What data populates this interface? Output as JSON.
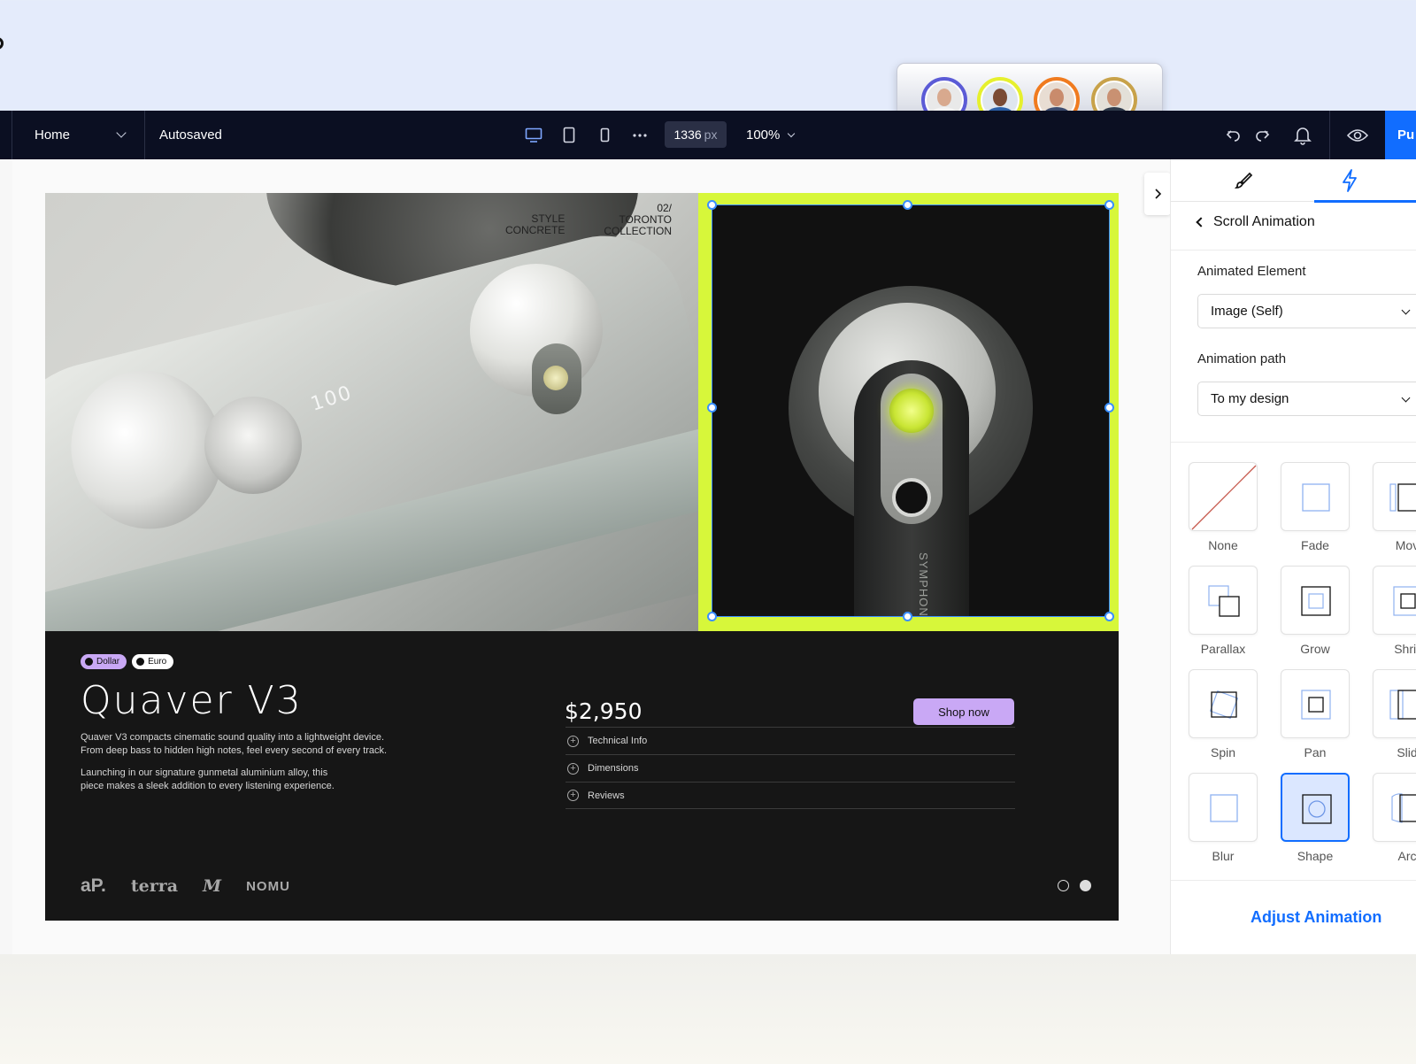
{
  "colors": {
    "topbar_bg": "#0b0f22",
    "accent": "#116dff",
    "selection_frame": "#d7f73a",
    "shop_button": "#c9a8f5"
  },
  "collaborators": {
    "avatars": [
      {
        "name": "collaborator-1",
        "ring": "#5b5bd6",
        "shirt": "#f2f2f2"
      },
      {
        "name": "collaborator-2",
        "ring": "#e6f02e",
        "shirt": "#2a5fa8"
      },
      {
        "name": "collaborator-3",
        "ring": "#f07b1f",
        "shirt": "#3a4a6e"
      },
      {
        "name": "collaborator-4",
        "ring": "#c8a24a",
        "shirt": "#2e3a4a"
      }
    ]
  },
  "topbar": {
    "page_label": "Home",
    "status": "Autosaved",
    "width_value": "1336",
    "width_unit": "px",
    "zoom": "100%",
    "more_icon": "ellipsis-icon",
    "publish_label": "Pu"
  },
  "site": {
    "hero": {
      "meta_left": [
        "STYLE",
        "CONCRETE"
      ],
      "meta_right": [
        "02/",
        "TORONTO",
        "COLLECTION"
      ],
      "engraving": "100",
      "vertical_text": "SYMPHON"
    },
    "currency": {
      "dollar": "Dollar",
      "euro": "Euro"
    },
    "title": "Quaver V3",
    "desc_1": [
      "Quaver V3 compacts cinematic sound quality into a lightweight device.",
      "From deep bass to hidden high notes, feel every second of every track."
    ],
    "desc_2": [
      "Launching in our signature gunmetal  aluminium alloy, this",
      "piece makes a sleek addition to every listening experience."
    ],
    "price": "$2,950",
    "shop_label": "Shop now",
    "accordion": [
      "Technical Info",
      "Dimensions",
      "Reviews"
    ],
    "logos": [
      "aP.",
      "terra",
      "M",
      "NOMU"
    ]
  },
  "panel": {
    "section_title": "Scroll Animation",
    "animated_element_label": "Animated Element",
    "animated_element_value": "Image (Self)",
    "path_label": "Animation path",
    "path_value": "To my design",
    "animations": [
      "None",
      "Fade",
      "Mov",
      "Parallax",
      "Grow",
      "Shrir",
      "Spin",
      "Pan",
      "Slid",
      "Blur",
      "Shape",
      "Arc"
    ],
    "selected_animation": "Shape",
    "adjust_label": "Adjust Animation"
  }
}
